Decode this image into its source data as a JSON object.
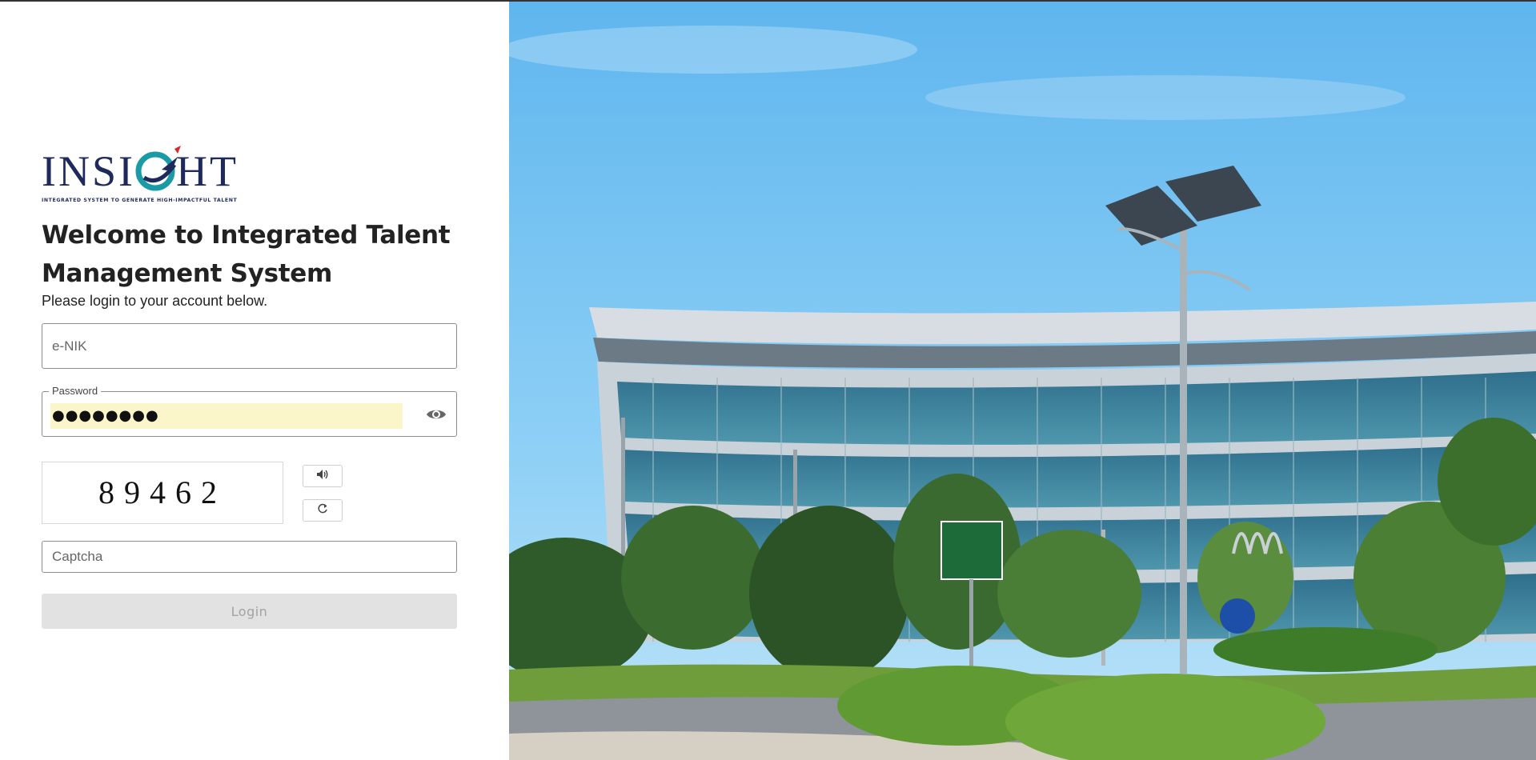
{
  "logo": {
    "brand_text": "INSIGHT",
    "tagline": "INTEGRATED SYSTEM TO GENERATE HIGH-IMPACTFUL TALENT"
  },
  "header": {
    "title": "Welcome to Integrated Talent Management System",
    "subtitle": "Please login to your account below."
  },
  "form": {
    "enik_placeholder": "e-NIK",
    "enik_value": "",
    "password_label": "Password",
    "password_value": "●●●●●●●●",
    "captcha_code": "89462",
    "captcha_placeholder": "Captcha",
    "captcha_value": "",
    "login_label": "Login"
  },
  "icons": {
    "password_toggle": "eye-icon",
    "audio": "speaker-icon",
    "refresh": "refresh-icon"
  },
  "colors": {
    "title": "#222222",
    "autofill": "#fbf6c9",
    "login_disabled_bg": "#e2e2e2",
    "login_disabled_text": "#a3a3a3",
    "logo_navy": "#1f2a5c",
    "logo_teal": "#1a9aa5",
    "logo_red": "#d9262b"
  }
}
